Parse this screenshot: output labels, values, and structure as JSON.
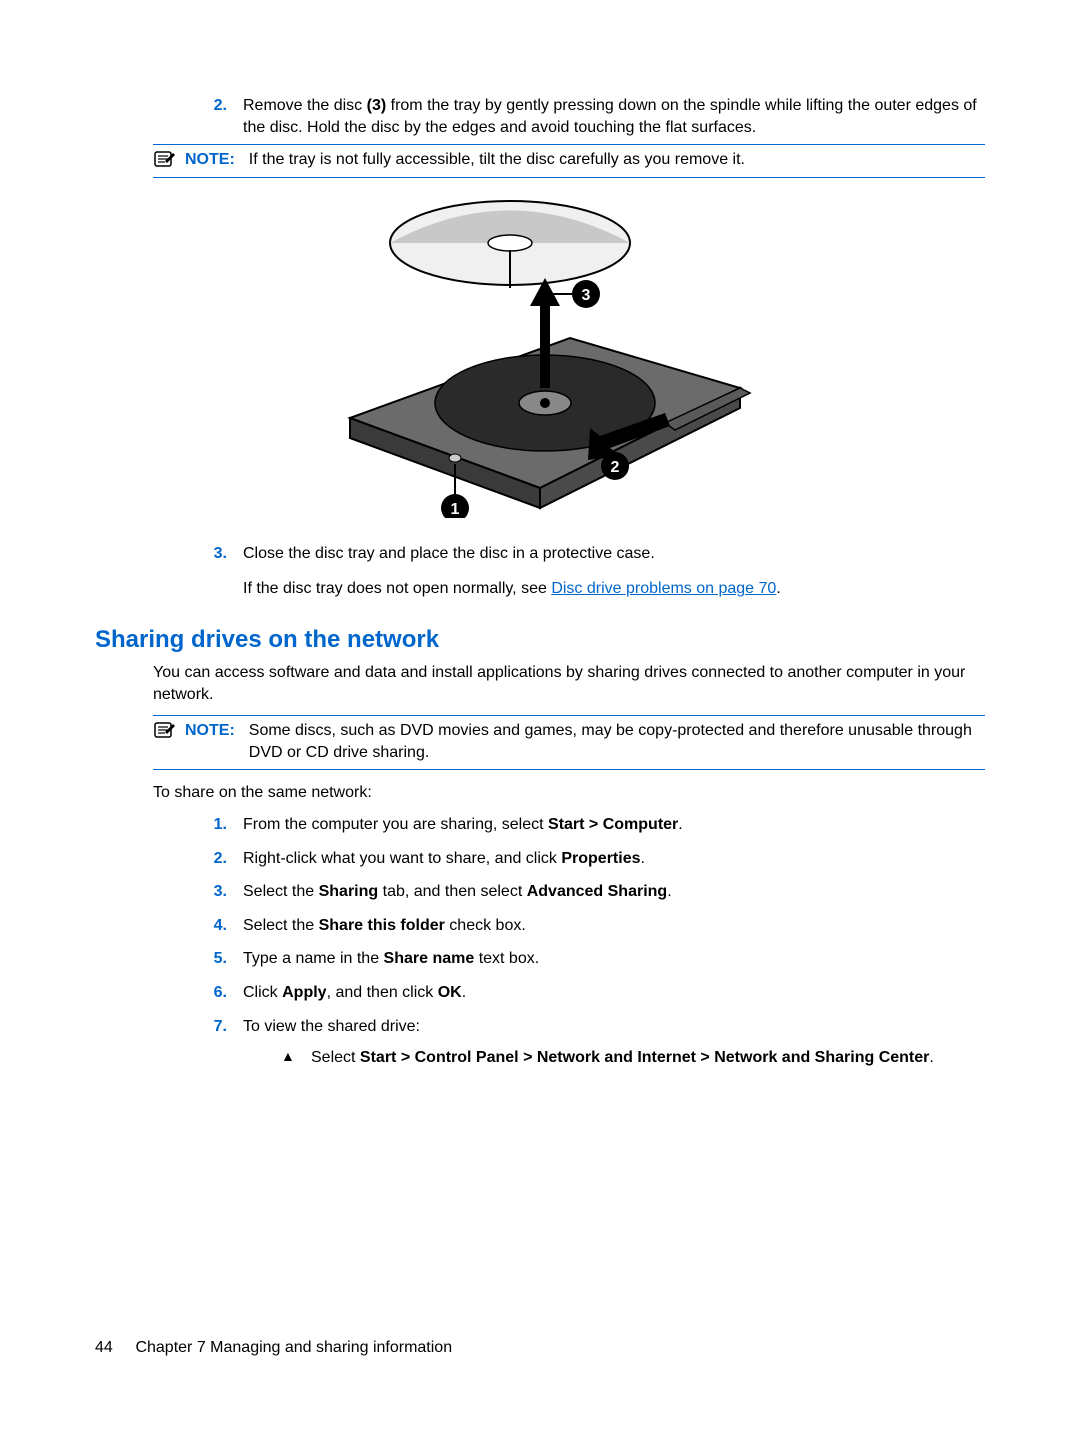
{
  "step2": {
    "num": "2.",
    "pre": "Remove the disc ",
    "bold": "(3)",
    "post": " from the tray by gently pressing down on the spindle while lifting the outer edges of the disc. Hold the disc by the edges and avoid touching the flat surfaces."
  },
  "note1": {
    "label": "NOTE:",
    "text": "If the tray is not fully accessible, tilt the disc carefully as you remove it."
  },
  "figure_alt": "Optical disc tray with disc lifted, callouts 1 2 3",
  "step3": {
    "num": "3.",
    "text": "Close the disc tray and place the disc in a protective case."
  },
  "tray_fail": {
    "pre": "If the disc tray does not open normally, see ",
    "link": "Disc drive problems on page 70",
    "post": "."
  },
  "heading": "Sharing drives on the network",
  "intro": "You can access software and data and install applications by sharing drives connected to another computer in your network.",
  "note2": {
    "label": "NOTE:",
    "text": "Some discs, such as DVD movies and games, may be copy-protected and therefore unusable through DVD or CD drive sharing."
  },
  "share_lead": "To share on the same network:",
  "steps": [
    {
      "num": "1.",
      "pre": "From the computer you are sharing, select ",
      "b1": "Start > Computer",
      "post": "."
    },
    {
      "num": "2.",
      "pre": "Right-click what you want to share, and click ",
      "b1": "Properties",
      "post": "."
    },
    {
      "num": "3.",
      "pre": "Select the ",
      "b1": "Sharing",
      "mid": " tab, and then select ",
      "b2": "Advanced Sharing",
      "post": "."
    },
    {
      "num": "4.",
      "pre": "Select the ",
      "b1": "Share this folder",
      "post": " check box."
    },
    {
      "num": "5.",
      "pre": "Type a name in the ",
      "b1": "Share name",
      "post": " text box."
    },
    {
      "num": "6.",
      "pre": "Click ",
      "b1": "Apply",
      "mid": ", and then click ",
      "b2": "OK",
      "post": "."
    },
    {
      "num": "7.",
      "pre": "To view the shared drive:",
      "b1": "",
      "post": ""
    }
  ],
  "substep": {
    "marker": "▲",
    "pre": "Select ",
    "bold": "Start > Control Panel > Network and Internet > Network and Sharing Center",
    "post": "."
  },
  "footer": {
    "page": "44",
    "chapter": "Chapter 7   Managing and sharing information"
  }
}
